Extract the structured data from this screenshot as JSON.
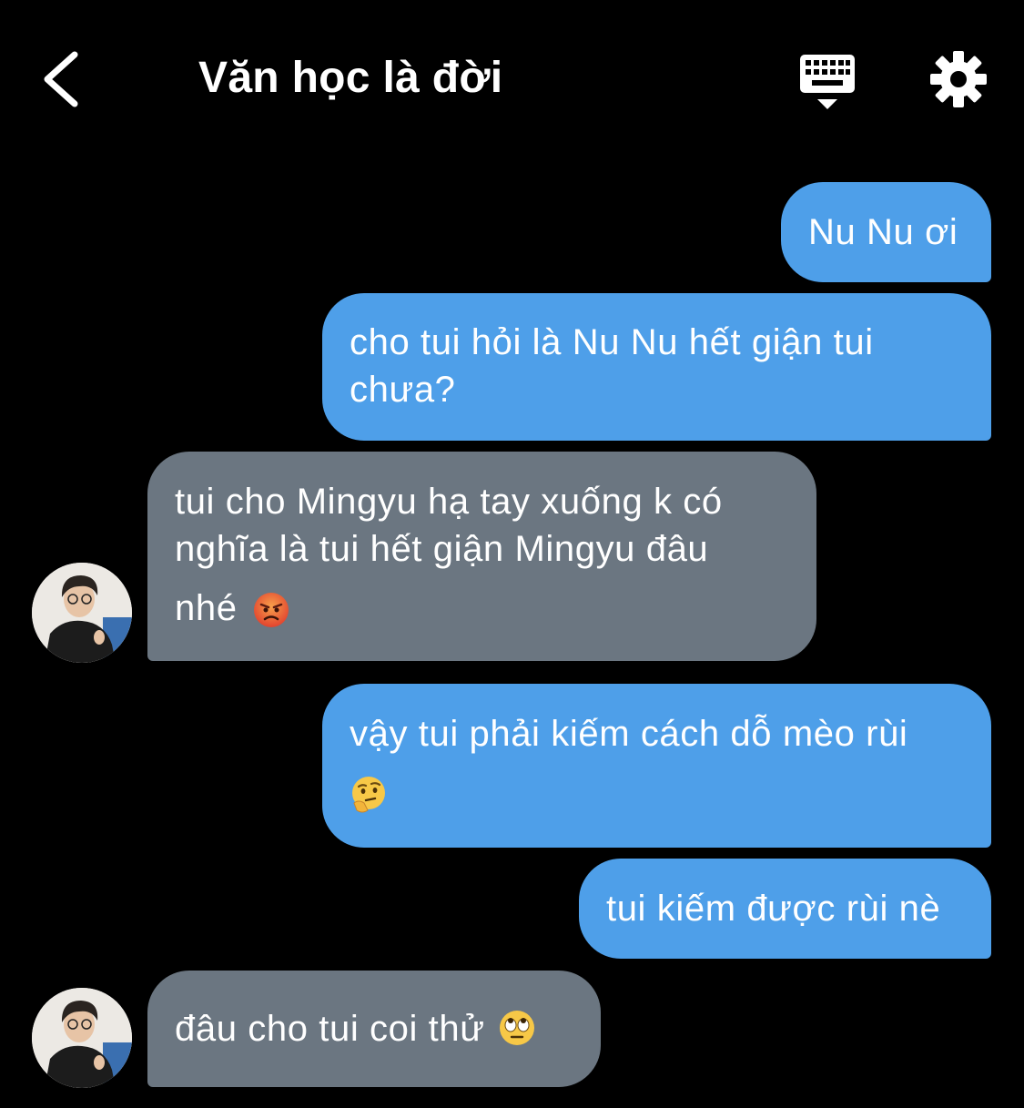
{
  "header": {
    "title": "Văn học là đời",
    "back_icon": "chevron-left-icon",
    "keyboard_icon": "keyboard-hide-icon",
    "settings_icon": "gear-icon"
  },
  "colors": {
    "background": "#000000",
    "outgoing_bubble": "#4e9fe9",
    "incoming_bubble": "#6b7681",
    "text": "#ffffff"
  },
  "messages": [
    {
      "direction": "out",
      "text": "Nu Nu ơi"
    },
    {
      "direction": "out",
      "line1": "cho tui hỏi là Nu Nu hết giận tui",
      "line2": "chưa?"
    },
    {
      "direction": "in",
      "line1": "tui cho Mingyu hạ tay xuống k có",
      "line2": "nghĩa là tui hết giận Mingyu đâu",
      "line3": "nhé",
      "emoji": "angry-face-emoji"
    },
    {
      "direction": "out",
      "line1": "vậy tui phải kiếm cách dỗ mèo rùi",
      "emoji": "thinking-face-emoji"
    },
    {
      "direction": "out",
      "text": "tui kiếm được rùi nè"
    },
    {
      "direction": "in",
      "text": "đâu cho tui coi thử",
      "emoji": "eye-roll-face-emoji"
    }
  ]
}
